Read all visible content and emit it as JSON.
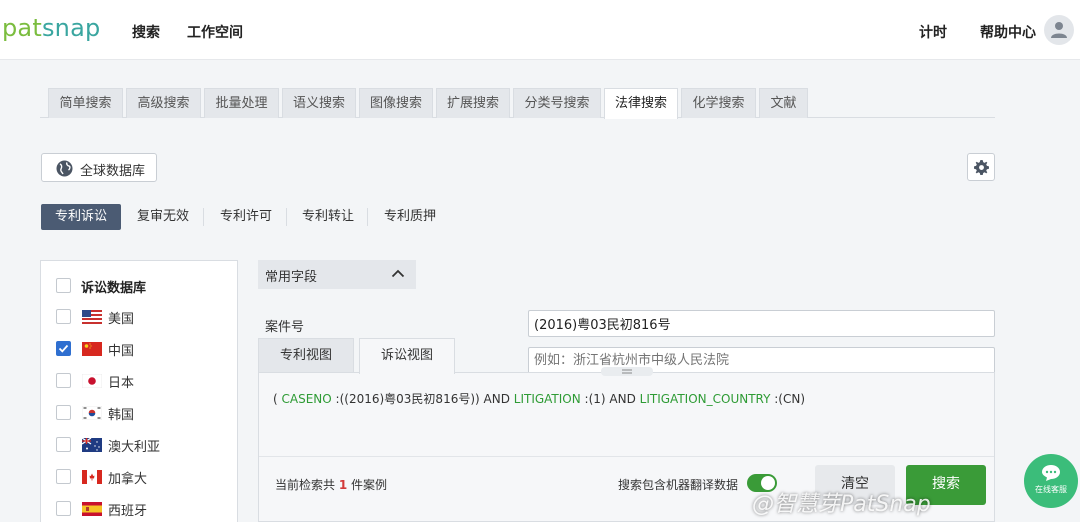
{
  "header": {
    "logo": "patsnap",
    "nav": [
      "搜索",
      "工作空间"
    ],
    "right": [
      "计时",
      "帮助中心"
    ]
  },
  "tabs": [
    "简单搜索",
    "高级搜索",
    "批量处理",
    "语义搜索",
    "图像搜索",
    "扩展搜索",
    "分类号搜索",
    "法律搜索",
    "化学搜索",
    "文献"
  ],
  "active_tab": "法律搜索",
  "db_button": "全球数据库",
  "subtabs": [
    "专利诉讼",
    "复审无效",
    "专利许可",
    "专利转让",
    "专利质押"
  ],
  "databases": {
    "header": "诉讼数据库",
    "items": [
      {
        "label": "美国",
        "checked": false,
        "flag": "us-flag-icon"
      },
      {
        "label": "中国",
        "checked": true,
        "flag": "cn-flag-icon"
      },
      {
        "label": "日本",
        "checked": false,
        "flag": "jp-flag-icon"
      },
      {
        "label": "韩国",
        "checked": false,
        "flag": "kr-flag-icon"
      },
      {
        "label": "澳大利亚",
        "checked": false,
        "flag": "au-flag-icon"
      },
      {
        "label": "加拿大",
        "checked": false,
        "flag": "ca-flag-icon"
      },
      {
        "label": "西班牙",
        "checked": false,
        "flag": "es-flag-icon"
      }
    ]
  },
  "fields": {
    "section": "常用字段",
    "case_label": "案件号",
    "case_value": "(2016)粤03民初816号",
    "court_placeholder": "例如：浙江省杭州市中级人民法院"
  },
  "views": [
    "专利视图",
    "诉讼视图"
  ],
  "query": {
    "p0": "( ",
    "k1": "CASENO",
    "p1": " :((2016)粤03民初816号)) AND ",
    "k2": "LITIGATION",
    "p2": " :(1) AND ",
    "k3": "LITIGATION_COUNTRY",
    "p3": " :(CN)"
  },
  "footer": {
    "count_prefix": "当前检索共",
    "count": "1",
    "count_suffix": "件案例",
    "mt_label": "搜索包含机器翻译数据",
    "mt_enabled": true,
    "clear": "清空",
    "search": "搜索"
  },
  "chat_label": "在线客服",
  "watermark": "@智慧芽PatSnap",
  "colors": {
    "accent_green": "#3a9b38",
    "active_subtab": "#4b5b73",
    "keyword": "#2e9b35",
    "count_red": "#d23a3a"
  }
}
